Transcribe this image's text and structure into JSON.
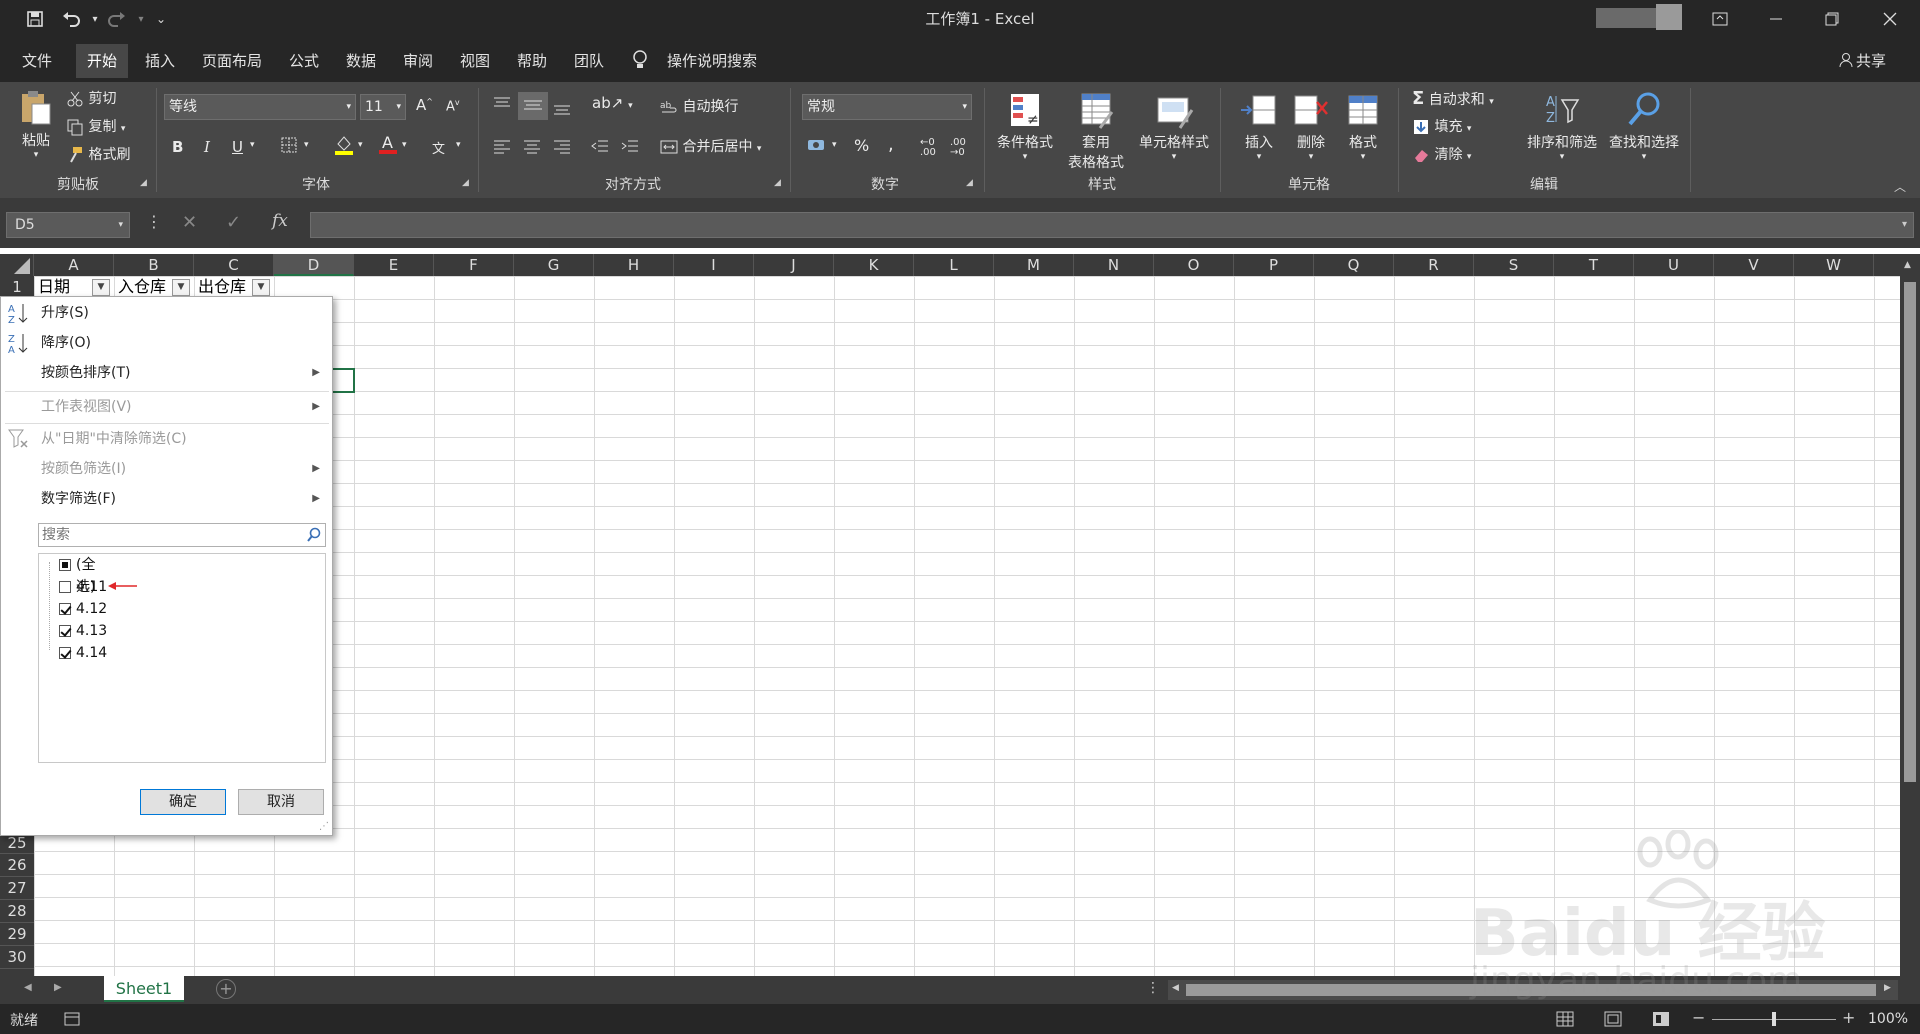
{
  "title_bar": {
    "title": "工作簿1  -  Excel"
  },
  "tabs": [
    "文件",
    "开始",
    "插入",
    "页面布局",
    "公式",
    "数据",
    "审阅",
    "视图",
    "帮助",
    "团队"
  ],
  "active_tab": "开始",
  "tell_me": "操作说明搜索",
  "share": "共享",
  "ribbon": {
    "clipboard": {
      "label": "剪贴板",
      "paste": "粘贴",
      "cut": "剪切",
      "copy": "复制",
      "format_painter": "格式刷"
    },
    "font": {
      "label": "字体",
      "name": "等线",
      "size": "11",
      "bold": "B",
      "italic": "I",
      "underline": "U"
    },
    "alignment": {
      "label": "对齐方式",
      "wrap": "自动换行",
      "merge": "合并后居中"
    },
    "number": {
      "label": "数字",
      "format": "常规",
      "percent": "%",
      "comma": ","
    },
    "styles": {
      "label": "样式",
      "conditional": "条件格式",
      "table_line1": "套用",
      "table_line2": "表格格式",
      "cell_styles": "单元格样式"
    },
    "cells": {
      "label": "单元格",
      "insert": "插入",
      "delete": "删除",
      "format": "格式"
    },
    "editing": {
      "label": "编辑",
      "autosum": "自动求和",
      "fill": "填充",
      "clear": "清除",
      "sort_filter": "排序和筛选",
      "find": "查找和选择"
    }
  },
  "name_box": "D5",
  "fx": "fx",
  "columns": [
    "A",
    "B",
    "C",
    "D",
    "E",
    "F",
    "G",
    "H",
    "I",
    "J",
    "K",
    "L",
    "M",
    "N",
    "O",
    "P",
    "Q",
    "R",
    "S",
    "T",
    "U",
    "V",
    "W"
  ],
  "rows_top": [
    "1"
  ],
  "rows_bottom": [
    "25",
    "26",
    "27",
    "28",
    "29",
    "30"
  ],
  "header_cells": [
    "日期",
    "入仓库",
    "出仓库"
  ],
  "filter_menu": {
    "sort_asc": "升序(S)",
    "sort_desc": "降序(O)",
    "sort_by_color": "按颜色排序(T)",
    "sheet_view": "工作表视图(V)",
    "clear_filter": "从\"日期\"中清除筛选(C)",
    "filter_by_color": "按颜色筛选(I)",
    "number_filter": "数字筛选(F)",
    "search_placeholder": "搜索",
    "select_all": "(全选)",
    "items": [
      {
        "label": "4.11",
        "checked": false
      },
      {
        "label": "4.12",
        "checked": true
      },
      {
        "label": "4.13",
        "checked": true
      },
      {
        "label": "4.14",
        "checked": true
      }
    ],
    "ok": "确定",
    "cancel": "取消"
  },
  "sheet_tab": "Sheet1",
  "status": {
    "ready": "就绪",
    "zoom": "100%"
  },
  "watermark": {
    "line1": "Baidu 经验",
    "line2": "jingyan.baidu.com"
  },
  "colors": {
    "excel_green": "#217346",
    "arrow_red": "#e0282a",
    "dark": "#262626",
    "ribbon": "#474747"
  }
}
